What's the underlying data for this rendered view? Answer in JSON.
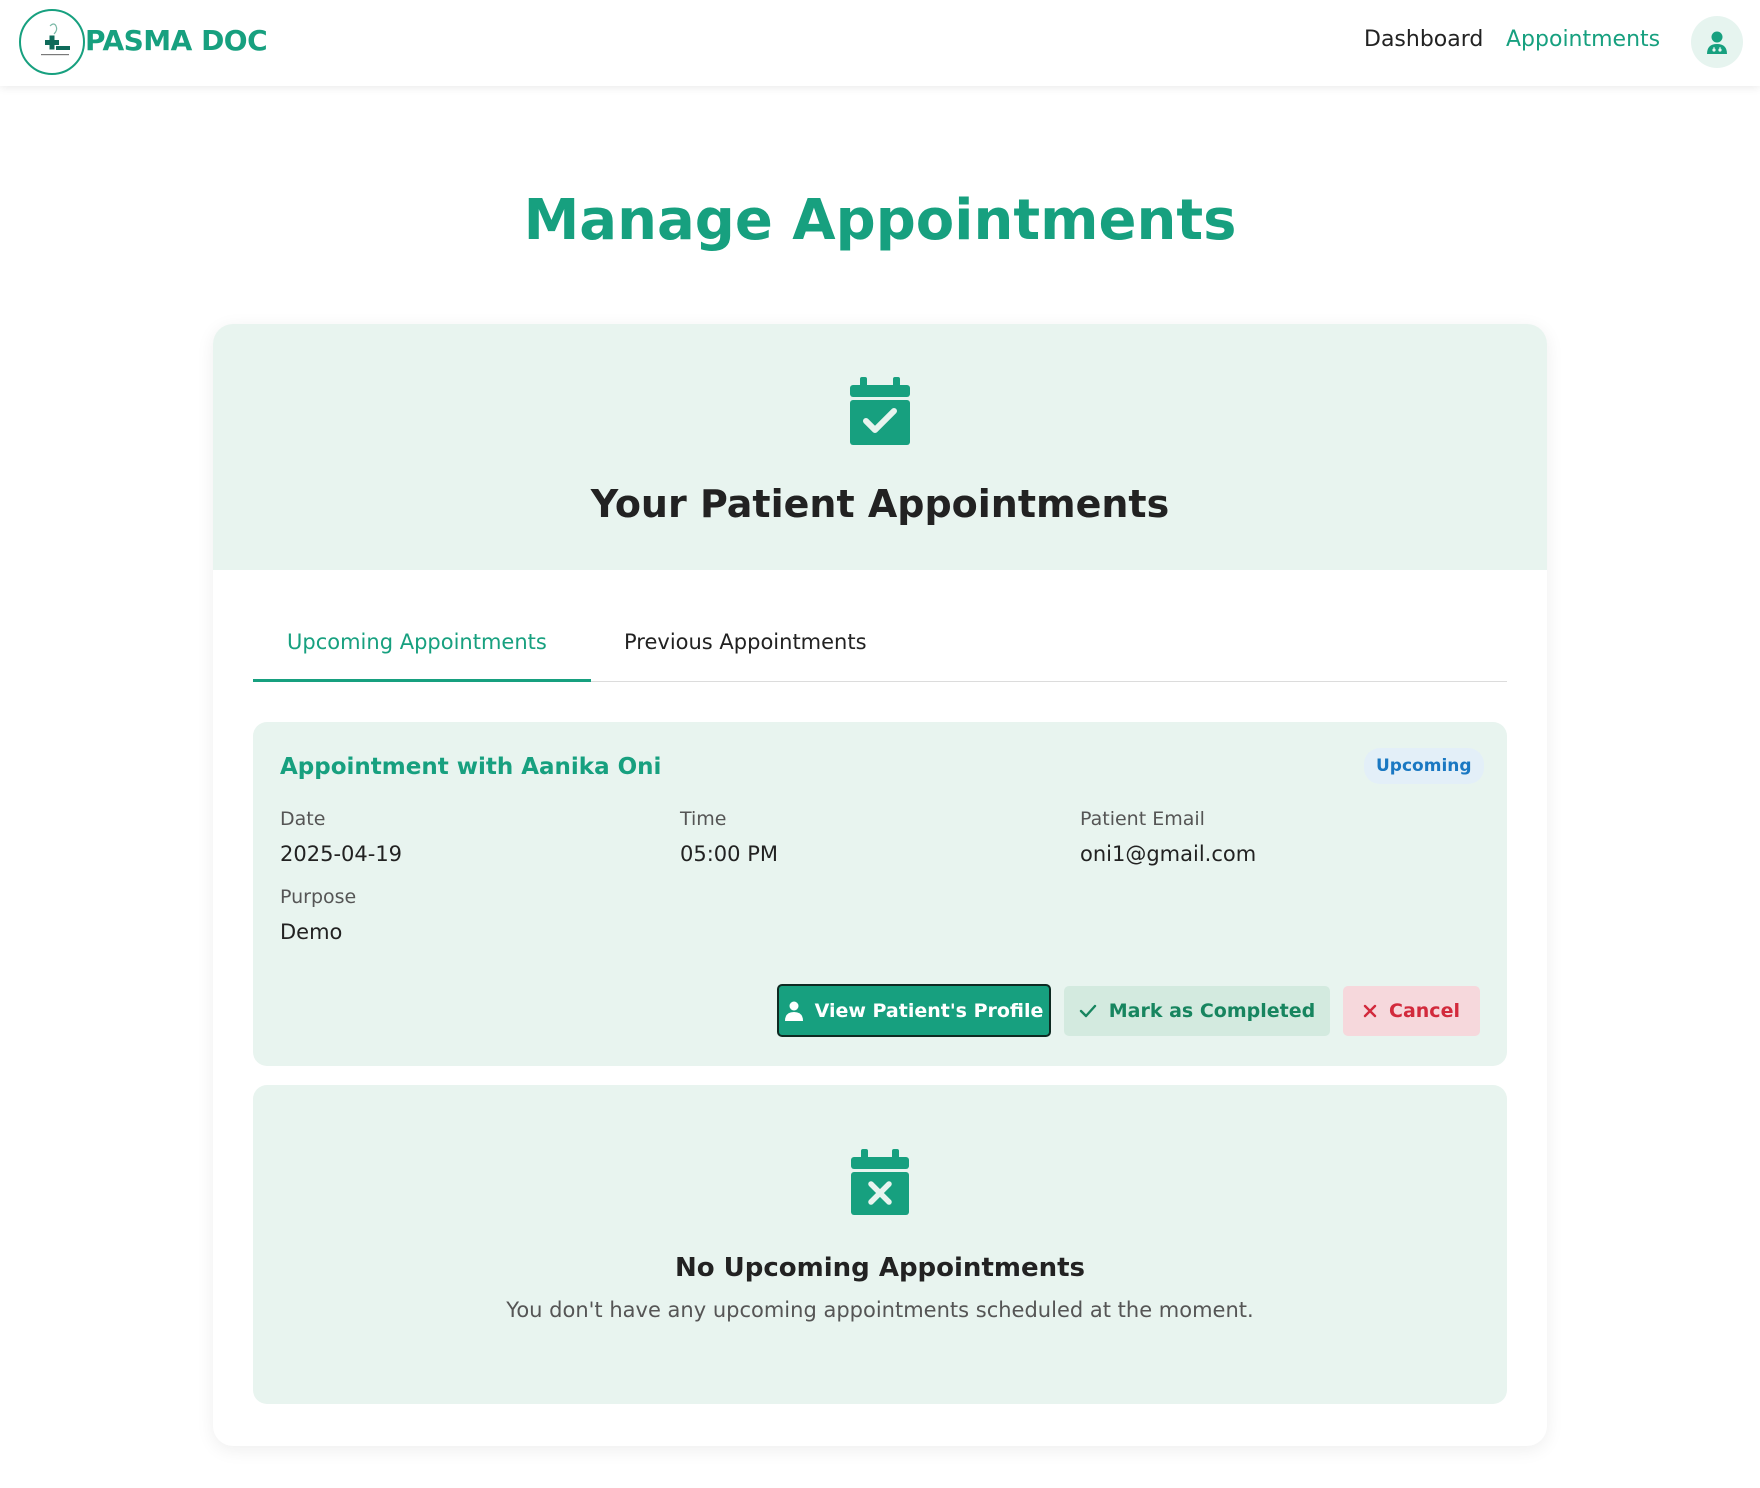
{
  "brand": {
    "name": "PASMA DOC",
    "logo_tagline": "PASMA DOC"
  },
  "nav": {
    "dashboard": "Dashboard",
    "appointments": "Appointments"
  },
  "page": {
    "title": "Manage Appointments"
  },
  "card": {
    "header_title": "Your Patient Appointments"
  },
  "tabs": {
    "upcoming": "Upcoming Appointments",
    "previous": "Previous Appointments"
  },
  "appointment": {
    "title": "Appointment with Aanika Oni",
    "status": "Upcoming",
    "date_label": "Date",
    "date_value": "2025-04-19",
    "time_label": "Time",
    "time_value": "05:00 PM",
    "email_label": "Patient Email",
    "email_value": "oni1@gmail.com",
    "purpose_label": "Purpose",
    "purpose_value": "Demo",
    "buttons": {
      "view_profile": "View Patient's Profile",
      "mark_completed": "Mark as Completed",
      "cancel": "Cancel"
    }
  },
  "empty_state": {
    "title": "No Upcoming Appointments",
    "message": "You don't have any upcoming appointments scheduled at the moment."
  },
  "colors": {
    "accent": "#17a07f",
    "panel_bg": "#e8f4ef",
    "badge_blue": "#1a78c2",
    "cancel_red": "#d22a3c"
  },
  "icons": {
    "logo": "medical-cross-logo",
    "avatar": "doctor-icon",
    "header": "calendar-check-icon",
    "empty": "calendar-x-icon"
  }
}
